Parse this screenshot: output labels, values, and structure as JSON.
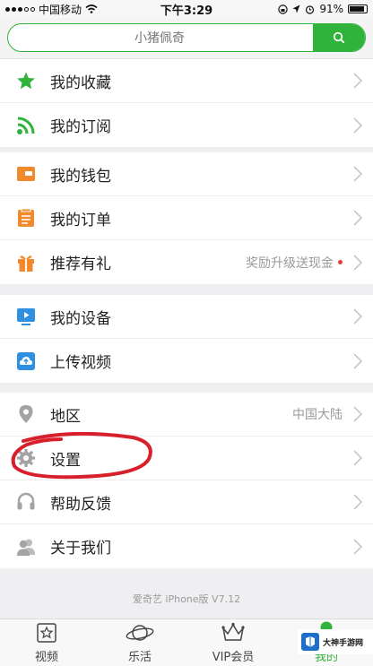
{
  "status_bar": {
    "carrier": "中国移动",
    "time": "下午3:29",
    "battery": "91%",
    "battery_level": 0.91
  },
  "search": {
    "placeholder": "小猪佩奇",
    "button_icon": "search-icon"
  },
  "groups": [
    {
      "items": [
        {
          "label": "我的收藏",
          "icon": "star-icon",
          "color": "#2fb33a"
        },
        {
          "label": "我的订阅",
          "icon": "rss-icon",
          "color": "#2fb33a"
        }
      ]
    },
    {
      "items": [
        {
          "label": "我的钱包",
          "icon": "wallet-icon",
          "color": "#f08a2c"
        },
        {
          "label": "我的订单",
          "icon": "order-icon",
          "color": "#f08a2c"
        },
        {
          "label": "推荐有礼",
          "icon": "gift-icon",
          "color": "#f08a2c",
          "extra": "奖励升级送现金"
        }
      ]
    },
    {
      "items": [
        {
          "label": "我的设备",
          "icon": "device-icon",
          "color": "#2f8fe0"
        },
        {
          "label": "上传视频",
          "icon": "upload-icon",
          "color": "#2f8fe0"
        }
      ]
    },
    {
      "items": [
        {
          "label": "地区",
          "icon": "location-icon",
          "color": "#9a9a9a",
          "extra": "中国大陆"
        },
        {
          "label": "设置",
          "icon": "gear-icon",
          "color": "#9a9a9a"
        },
        {
          "label": "帮助反馈",
          "icon": "headset-icon",
          "color": "#9a9a9a"
        },
        {
          "label": "关于我们",
          "icon": "users-icon",
          "color": "#9a9a9a"
        }
      ]
    }
  ],
  "version_text": "爱奇艺 iPhone版 V7.12",
  "tabs": [
    {
      "label": "视频",
      "icon": "video-icon"
    },
    {
      "label": "乐活",
      "icon": "planet-icon"
    },
    {
      "label": "VIP会员",
      "icon": "crown-icon"
    },
    {
      "label": "我的",
      "icon": "profile-icon",
      "active": true
    }
  ],
  "watermark": {
    "text": "大神手游网"
  },
  "colors": {
    "accent": "#2fb33a",
    "orange": "#f08a2c",
    "blue": "#2f8fe0",
    "annotation": "#d8202c"
  }
}
